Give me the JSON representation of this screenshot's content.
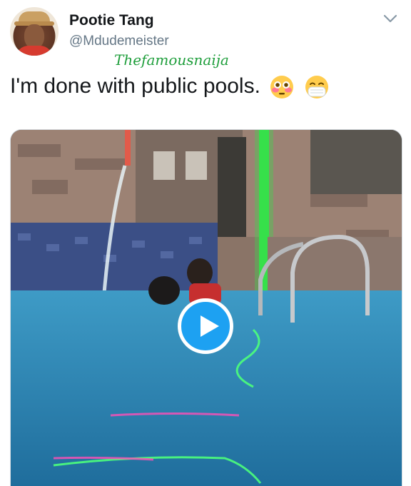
{
  "user": {
    "display_name": "Pootie Tang",
    "handle": "@Mdudemeister",
    "avatar_icon": "profile-avatar"
  },
  "watermark": "Thefamousnaija",
  "tweet": {
    "text": "I'm done with public pools.",
    "emojis": [
      "flushed-face-emoji",
      "face-with-medical-mask-emoji"
    ]
  },
  "media": {
    "type": "video",
    "play_icon": "play-icon",
    "accent": "#1da1f2"
  },
  "menu": {
    "icon": "chevron-down-icon"
  }
}
